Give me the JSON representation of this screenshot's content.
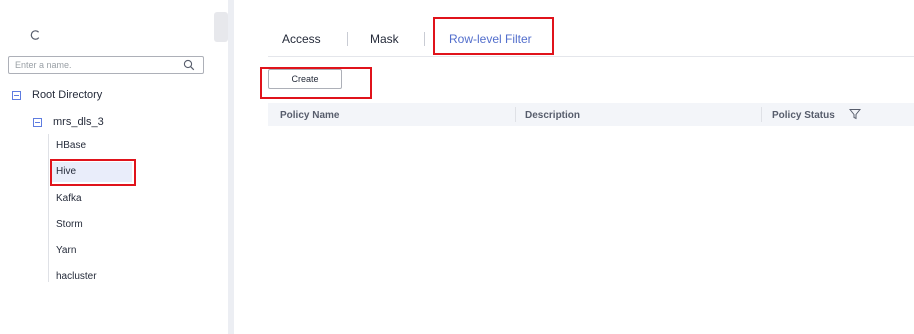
{
  "tree": {
    "search_placeholder": "Enter a name.",
    "root_label": "Root Directory",
    "cluster_label": "mrs_dls_3",
    "services": [
      "HBase",
      "Hive",
      "Kafka",
      "Storm",
      "Yarn",
      "hacluster"
    ],
    "selected_service": "Hive"
  },
  "tabs": [
    "Access",
    "Mask",
    "Row-level Filter"
  ],
  "active_tab": "Row-level Filter",
  "toolbar": {
    "create_label": "Create"
  },
  "table": {
    "columns": [
      "Policy Name",
      "Description",
      "Policy Status"
    ]
  },
  "colors": {
    "accent": "#526ecc",
    "highlight_box": "#e0131b",
    "selected_bg": "#e9edfa",
    "header_bg": "#f3f5f9"
  },
  "icons": [
    "refresh-icon",
    "search-icon",
    "collapse-icon",
    "filter-icon"
  ]
}
